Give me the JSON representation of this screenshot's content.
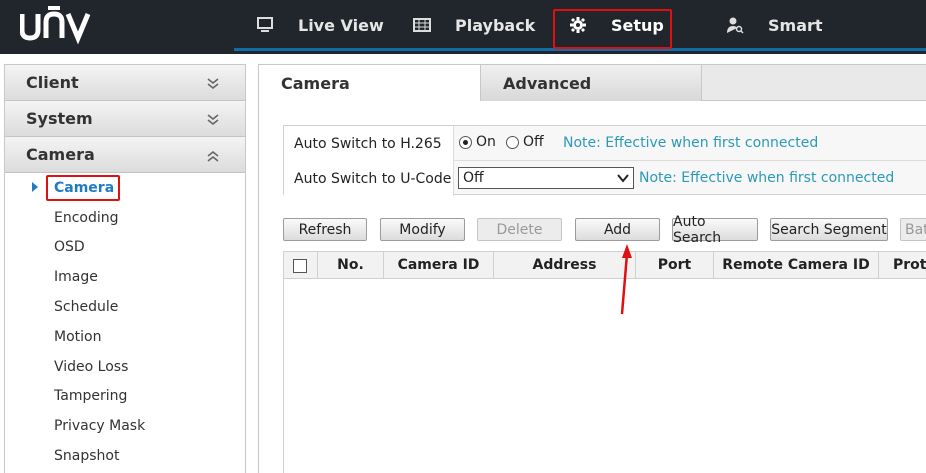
{
  "brand": {
    "logo_text": "unv"
  },
  "topnav": {
    "items": [
      {
        "label": "Live View",
        "icon": "monitor-icon"
      },
      {
        "label": "Playback",
        "icon": "film-icon"
      },
      {
        "label": "Setup",
        "icon": "gear-icon"
      },
      {
        "label": "Smart",
        "icon": "person-search-icon"
      }
    ],
    "active": "Setup"
  },
  "sidebar": {
    "sections": [
      {
        "label": "Client",
        "state": "collapsed"
      },
      {
        "label": "System",
        "state": "collapsed"
      },
      {
        "label": "Camera",
        "state": "expanded"
      }
    ],
    "camera_items": [
      "Camera",
      "Encoding",
      "OSD",
      "Image",
      "Schedule",
      "Motion",
      "Video Loss",
      "Tampering",
      "Privacy Mask",
      "Snapshot"
    ],
    "active_item": "Camera"
  },
  "tabs": [
    {
      "label": "Camera",
      "active": true
    },
    {
      "label": "Advanced",
      "active": false
    }
  ],
  "settings": {
    "h265": {
      "label": "Auto Switch to H.265",
      "on_label": "On",
      "off_label": "Off",
      "selected": "On",
      "note": "Note: Effective when first connected"
    },
    "ucode": {
      "label": "Auto Switch to U-Code",
      "value": "Off",
      "note": "Note: Effective when first connected"
    }
  },
  "toolbar": {
    "refresh": "Refresh",
    "modify": "Modify",
    "delete": "Delete",
    "add": "Add",
    "auto_search": "Auto Search",
    "search_segment": "Search Segment",
    "batch_truncated": "Batc"
  },
  "table": {
    "columns": [
      "No.",
      "Camera ID",
      "Address",
      "Port",
      "Remote Camera ID",
      "Proto"
    ]
  },
  "colors": {
    "topbar": "#21262c",
    "accent_blue": "#1f7cc4",
    "note_teal": "#2a9ab8",
    "highlight_red": "#e01010"
  }
}
